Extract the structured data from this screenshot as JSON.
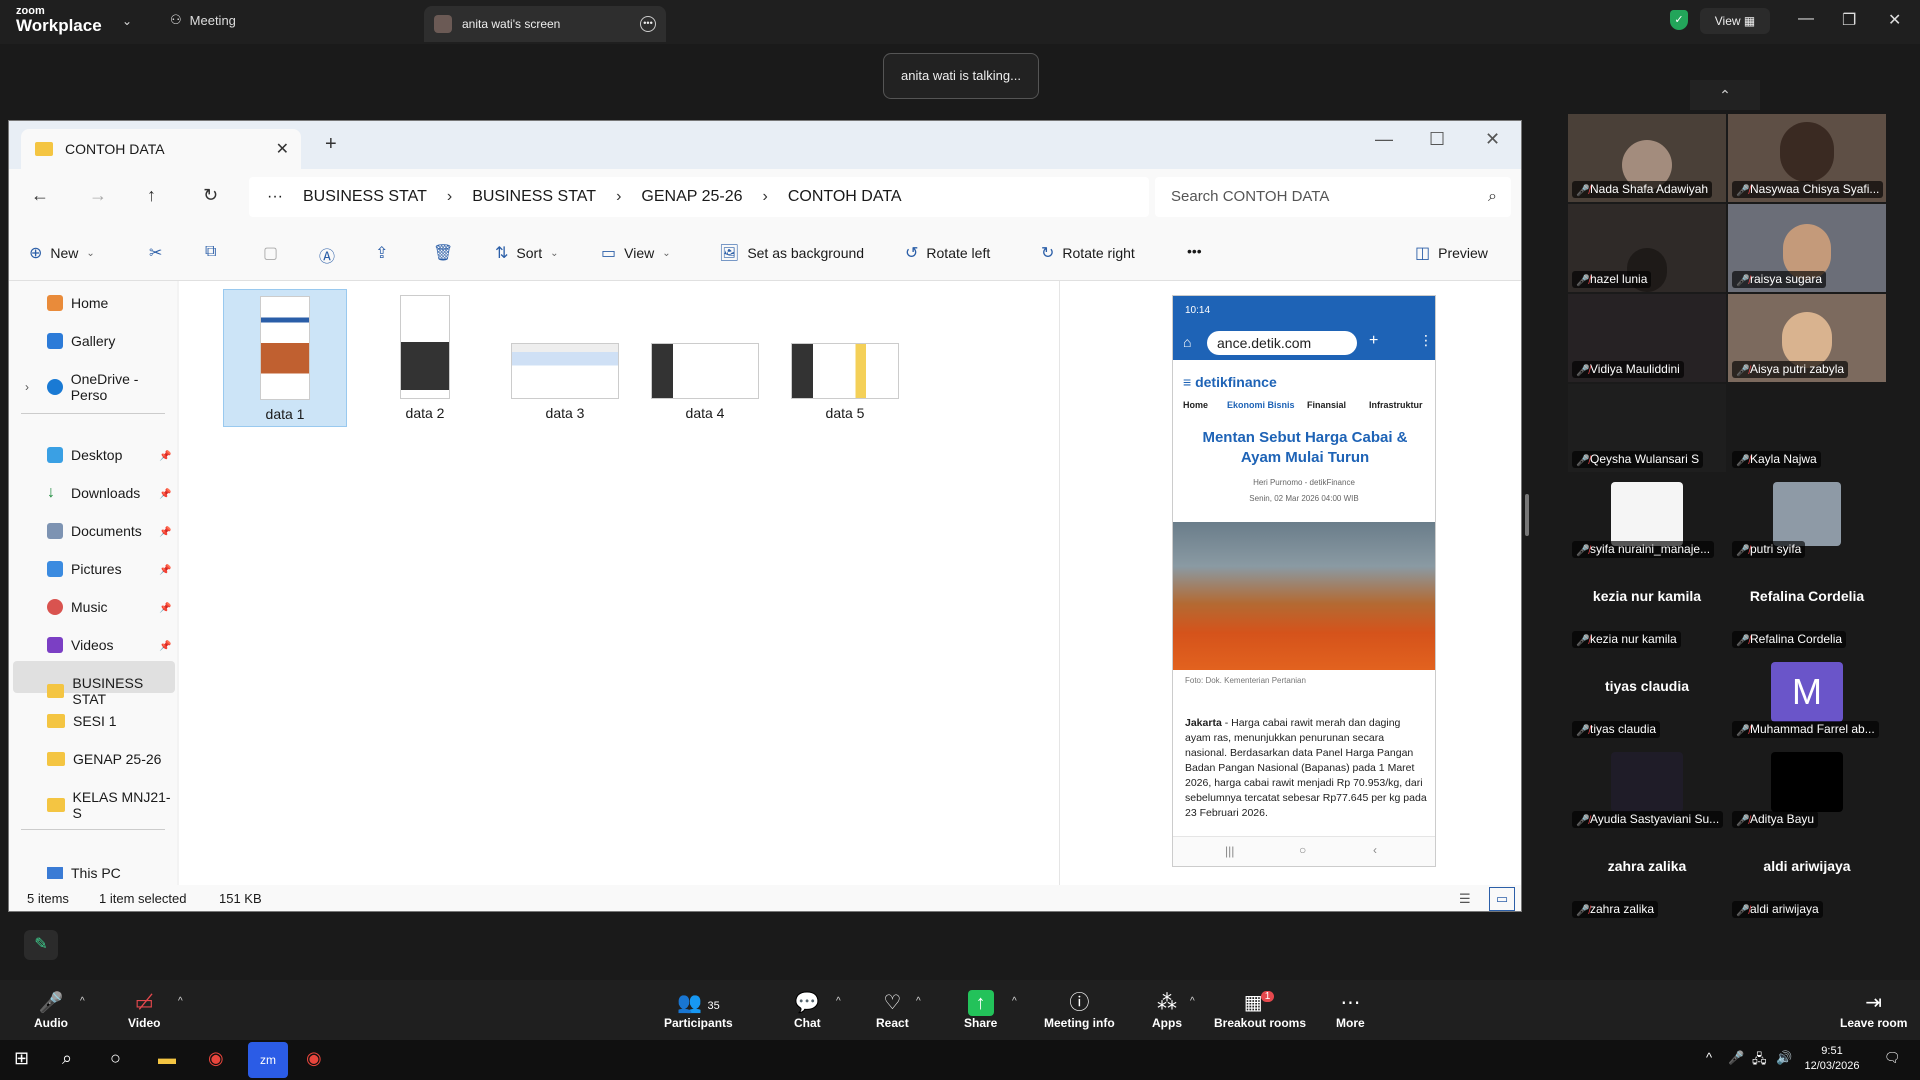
{
  "zoom": {
    "logo_top": "zoom",
    "logo_bottom": "Workplace",
    "meeting_tab": "Meeting",
    "screen_tab": "anita wati's screen",
    "view_label": "View",
    "toast": "anita wati is talking..."
  },
  "explorer": {
    "tab_title": "CONTOH DATA",
    "breadcrumbs": [
      "BUSINESS STAT",
      "BUSINESS STAT",
      "GENAP 25-26",
      "CONTOH DATA"
    ],
    "search_placeholder": "Search CONTOH DATA",
    "commands": {
      "new": "New",
      "sort": "Sort",
      "view": "View",
      "set_bg": "Set as background",
      "rotate_left": "Rotate left",
      "rotate_right": "Rotate right",
      "more": "•••",
      "preview": "Preview"
    },
    "sidebar": [
      "Home",
      "Gallery",
      "OneDrive - Perso",
      "Desktop",
      "Downloads",
      "Documents",
      "Pictures",
      "Music",
      "Videos",
      "BUSINESS STAT",
      "SESI 1",
      "GENAP 25-26",
      "KELAS MNJ21-S",
      "This PC"
    ],
    "files": [
      "data 1",
      "data 2",
      "data 3",
      "data 4",
      "data 5"
    ],
    "status": {
      "items": "5 items",
      "selected": "1 item selected",
      "size": "151 KB"
    },
    "preview": {
      "time": "10:14",
      "url": "ance.detik.com",
      "site": "detikfinance",
      "nav": [
        "Home",
        "Ekonomi Bisnis",
        "Finansial",
        "Infrastruktur"
      ],
      "headline": "Mentan Sebut Harga Cabai & Ayam Mulai Turun",
      "author": "Heri Purnomo - detikFinance",
      "date": "Senin, 02 Mar 2026 04:00 WIB",
      "caption": "Foto: Dok. Kementerian Pertanian",
      "article_lead": "Jakarta",
      "article_body": " - Harga cabai rawit merah dan daging ayam ras, menunjukkan penurunan secara nasional. Berdasarkan data Panel Harga Pangan Badan Pangan Nasional (Bapanas) pada 1 Maret 2026, harga cabai rawit menjadi Rp 70.953/kg, dari sebelumnya tercatat sebesar Rp77.645 per kg pada 23 Februari 2026."
    }
  },
  "participants": [
    {
      "name": "Nada Shafa Adawiyah"
    },
    {
      "name": "Nasywaa Chisya Syafi..."
    },
    {
      "name": "hazel lunia"
    },
    {
      "name": "raisya sugara"
    },
    {
      "name": "Vidiya Mauliddini"
    },
    {
      "name": "Aisya putri zabyla"
    },
    {
      "name": "Qeysha Wulansari S"
    },
    {
      "name": "Kayla Najwa"
    },
    {
      "name": "syifa nuraini_manaje..."
    },
    {
      "name": "putri syifa"
    },
    {
      "name": "kezia nur kamila",
      "big": "kezia nur kamila"
    },
    {
      "name": "Refalina Cordelia",
      "big": "Refalina Cordelia"
    },
    {
      "name": "tiyas claudia",
      "big": "tiyas claudia"
    },
    {
      "name": "Muhammad Farrel ab...",
      "initial": "M"
    },
    {
      "name": "Ayudia Sastyaviani Su..."
    },
    {
      "name": "Aditya Bayu"
    },
    {
      "name": "zahra zalika",
      "big": "zahra zalika"
    },
    {
      "name": "aldi ariwijaya",
      "big": "aldi ariwijaya"
    }
  ],
  "toolbar": {
    "audio": "Audio",
    "video": "Video",
    "participants": "Participants",
    "participant_count": "35",
    "chat": "Chat",
    "react": "React",
    "share": "Share",
    "meeting_info": "Meeting info",
    "apps": "Apps",
    "breakout": "Breakout rooms",
    "breakout_badge": "1",
    "more": "More",
    "leave": "Leave room"
  },
  "taskbar": {
    "time": "9:51",
    "date": "12/03/2026"
  }
}
